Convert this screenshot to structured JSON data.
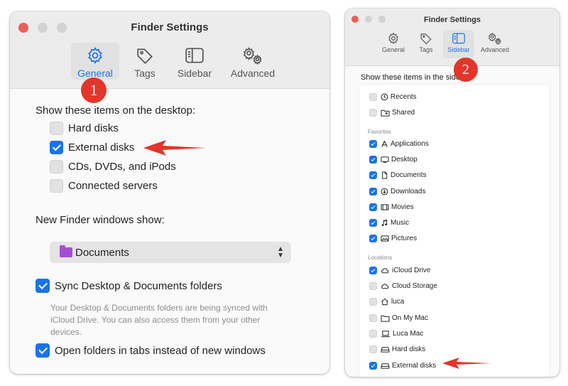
{
  "window1": {
    "title": "Finder Settings",
    "tabs": [
      {
        "label": "General",
        "icon": "gear-icon",
        "active": true
      },
      {
        "label": "Tags",
        "icon": "tag-icon",
        "active": false
      },
      {
        "label": "Sidebar",
        "icon": "sidebar-icon",
        "active": false
      },
      {
        "label": "Advanced",
        "icon": "gears-icon",
        "active": false
      }
    ],
    "desktop_heading": "Show these items on the desktop:",
    "desktop_items": [
      {
        "label": "Hard disks",
        "checked": false
      },
      {
        "label": "External disks",
        "checked": true
      },
      {
        "label": "CDs, DVDs, and iPods",
        "checked": false
      },
      {
        "label": "Connected servers",
        "checked": false
      }
    ],
    "new_window_heading": "New Finder windows show:",
    "new_window_value": "Documents",
    "sync_label": "Sync Desktop & Documents folders",
    "sync_checked": true,
    "sync_help": "Your Desktop & Documents folders are being synced with iCloud Drive. You can also access them from your other devices.",
    "tabs_label": "Open folders in tabs instead of new windows",
    "tabs_checked": true
  },
  "window2": {
    "title": "Finder Settings",
    "tabs": [
      {
        "label": "General",
        "icon": "gear-icon",
        "active": false
      },
      {
        "label": "Tags",
        "icon": "tag-icon",
        "active": false
      },
      {
        "label": "Sidebar",
        "icon": "sidebar-icon",
        "active": true
      },
      {
        "label": "Advanced",
        "icon": "gears-icon",
        "active": false
      }
    ],
    "heading": "Show these items in the side",
    "recents": [
      {
        "label": "Recents",
        "icon": "clock-icon",
        "checked": false
      },
      {
        "label": "Shared",
        "icon": "shared-folder-icon",
        "checked": false
      }
    ],
    "favorites_heading": "Favorites",
    "favorites": [
      {
        "label": "Applications",
        "icon": "applications-icon",
        "checked": true
      },
      {
        "label": "Desktop",
        "icon": "desktop-icon",
        "checked": true
      },
      {
        "label": "Documents",
        "icon": "document-icon",
        "checked": true
      },
      {
        "label": "Downloads",
        "icon": "download-icon",
        "checked": true
      },
      {
        "label": "Movies",
        "icon": "film-icon",
        "checked": true
      },
      {
        "label": "Music",
        "icon": "music-note-icon",
        "checked": true
      },
      {
        "label": "Pictures",
        "icon": "photo-icon",
        "checked": true
      }
    ],
    "locations_heading": "Locations",
    "locations": [
      {
        "label": "iCloud Drive",
        "icon": "cloud-icon",
        "checked": true
      },
      {
        "label": "Cloud Storage",
        "icon": "cloud-icon",
        "checked": false
      },
      {
        "label": "luca",
        "icon": "home-icon",
        "checked": false
      },
      {
        "label": "On My Mac",
        "icon": "folder-icon",
        "checked": false
      },
      {
        "label": "Luca Mac",
        "icon": "laptop-icon",
        "checked": false
      },
      {
        "label": "Hard disks",
        "icon": "disk-icon",
        "checked": false
      },
      {
        "label": "External disks",
        "icon": "disk-icon",
        "checked": true
      }
    ]
  },
  "badges": [
    "1",
    "2"
  ],
  "colors": {
    "accent": "#1a73e8",
    "annotation": "#e3352a",
    "close": "#ee5d57"
  }
}
